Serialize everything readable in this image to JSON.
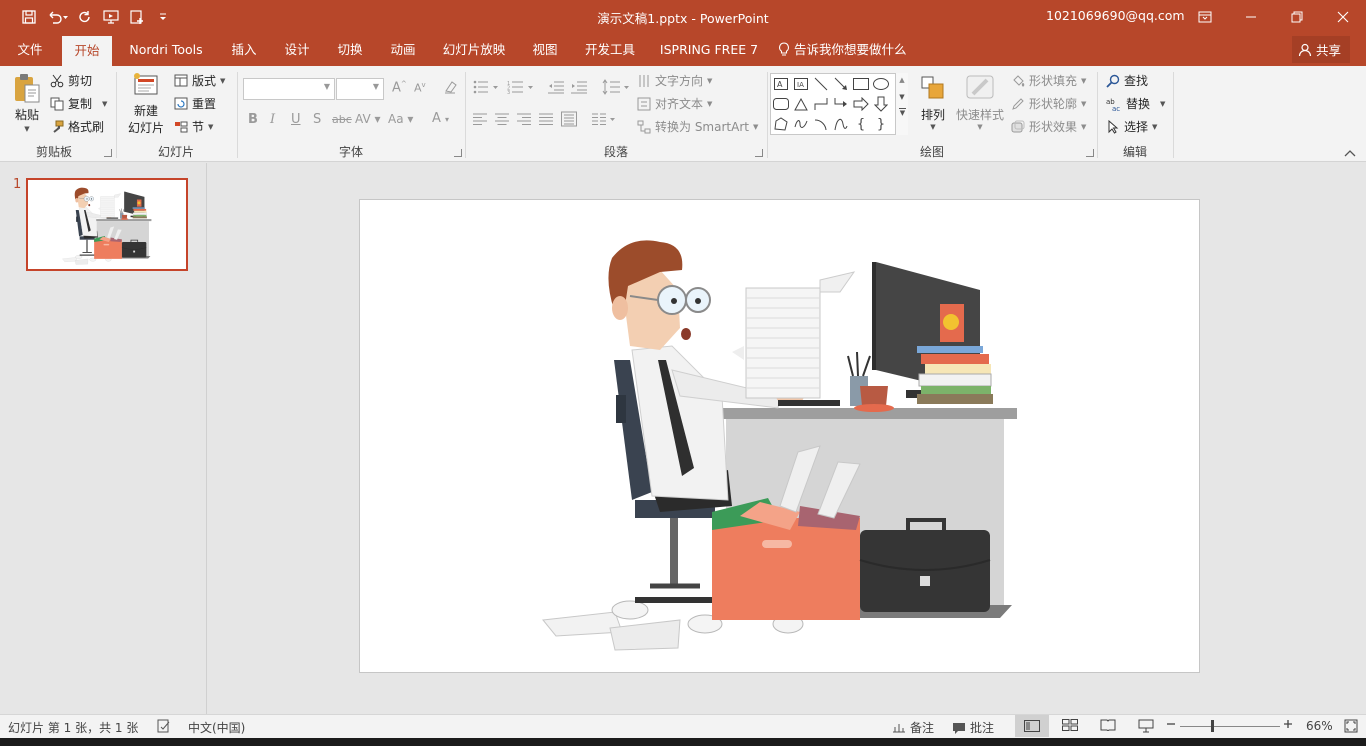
{
  "window": {
    "title": "演示文稿1.pptx - PowerPoint",
    "account": "1021069690@qq.com"
  },
  "tabs": [
    {
      "label": "文件"
    },
    {
      "label": "开始"
    },
    {
      "label": "Nordri Tools"
    },
    {
      "label": "插入"
    },
    {
      "label": "设计"
    },
    {
      "label": "切换"
    },
    {
      "label": "动画"
    },
    {
      "label": "幻灯片放映"
    },
    {
      "label": "视图"
    },
    {
      "label": "开发工具"
    },
    {
      "label": "ISPRING FREE 7"
    }
  ],
  "tell_me": "告诉我你想要做什么",
  "share": "共享",
  "ribbon": {
    "clipboard": {
      "paste": "粘贴",
      "cut": "剪切",
      "copy": "复制",
      "format_painter": "格式刷",
      "label": "剪贴板"
    },
    "slides": {
      "new_slide_line1": "新建",
      "new_slide_line2": "幻灯片",
      "layout": "版式",
      "reset": "重置",
      "section": "节",
      "label": "幻灯片"
    },
    "font": {
      "label": "字体"
    },
    "paragraph": {
      "text_direction": "文字方向",
      "align_text": "对齐文本",
      "smartart": "转换为 SmartArt",
      "label": "段落"
    },
    "drawing": {
      "arrange": "排列",
      "quick_styles": "快速样式",
      "shape_fill": "形状填充",
      "shape_outline": "形状轮廓",
      "shape_effects": "形状效果",
      "label": "绘图"
    },
    "editing": {
      "find": "查找",
      "replace": "替换",
      "select": "选择",
      "label": "编辑"
    }
  },
  "thumbnail": {
    "number": "1"
  },
  "status": {
    "slide_info": "幻灯片 第 1 张，共 1 张",
    "language": "中文(中国)",
    "notes": "备注",
    "comments": "批注",
    "zoom": "66%"
  },
  "zoom_level": 0.66
}
